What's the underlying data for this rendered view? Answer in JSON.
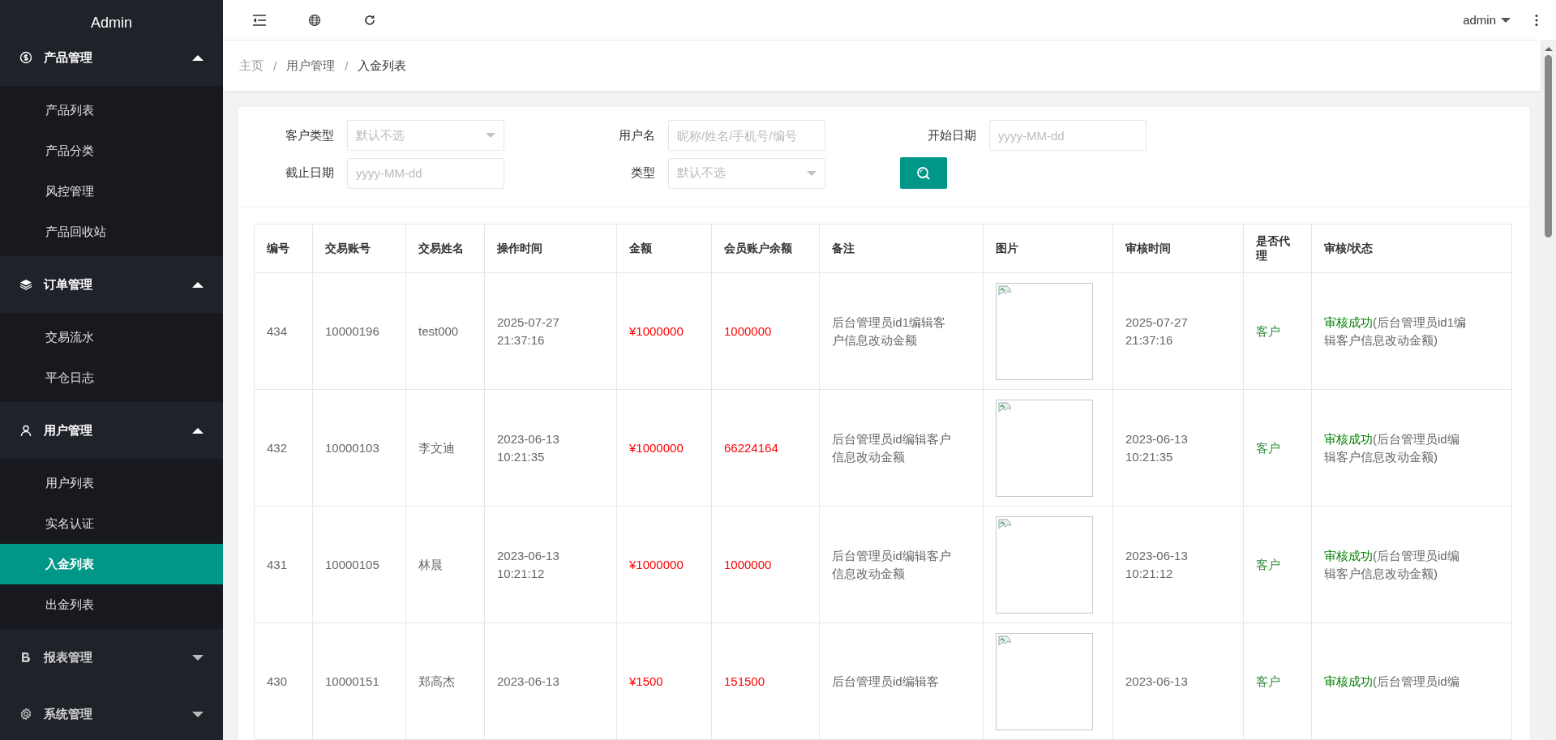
{
  "sidebar": {
    "brand": "Admin",
    "groups": [
      {
        "label": "产品管理",
        "expanded": true,
        "items": [
          {
            "label": "产品列表",
            "selected": false
          },
          {
            "label": "产品分类",
            "selected": false
          },
          {
            "label": "风控管理",
            "selected": false
          },
          {
            "label": "产品回收站",
            "selected": false
          }
        ]
      },
      {
        "label": "订单管理",
        "expanded": true,
        "items": [
          {
            "label": "交易流水",
            "selected": false
          },
          {
            "label": "平仓日志",
            "selected": false
          }
        ]
      },
      {
        "label": "用户管理",
        "expanded": true,
        "items": [
          {
            "label": "用户列表",
            "selected": false
          },
          {
            "label": "实名认证",
            "selected": false
          },
          {
            "label": "入金列表",
            "selected": true
          },
          {
            "label": "出金列表",
            "selected": false
          }
        ]
      },
      {
        "label": "报表管理",
        "expanded": false
      },
      {
        "label": "系统管理",
        "expanded": false
      }
    ]
  },
  "header": {
    "user": "admin"
  },
  "breadcrumb": {
    "separator": "/",
    "items": [
      "主页",
      "用户管理",
      "入金列表"
    ]
  },
  "filters": [
    {
      "label": "客户类型",
      "kind": "select",
      "placeholder": "默认不选"
    },
    {
      "label": "用户名",
      "kind": "input",
      "placeholder": "昵称/姓名/手机号/编号"
    },
    {
      "label": "开始日期",
      "kind": "input",
      "placeholder": "yyyy-MM-dd"
    },
    {
      "label": "截止日期",
      "kind": "input",
      "placeholder": "yyyy-MM-dd"
    },
    {
      "label": "类型",
      "kind": "select",
      "placeholder": "默认不选"
    }
  ],
  "table": {
    "columns": [
      "编号",
      "交易账号",
      "交易姓名",
      "操作时间",
      "金额",
      "会员账户余额",
      "备注",
      "图片",
      "审核时间",
      "是否代理",
      "审核/状态"
    ],
    "rows": [
      {
        "id": "434",
        "account": "10000196",
        "name": "test000",
        "op_time": "2025-07-27 21:37:16",
        "amount": "¥1000000",
        "balance": "1000000",
        "remark": "后台管理员id1编辑客户信息改动金额",
        "audit_time": "2025-07-27 21:37:16",
        "agent": "客户",
        "result": "审核成功",
        "note": "(后台管理员id1编辑客户信息改动金额)"
      },
      {
        "id": "432",
        "account": "10000103",
        "name": "李文迪",
        "op_time": "2023-06-13 10:21:35",
        "amount": "¥1000000",
        "balance": "66224164",
        "remark": "后台管理员id编辑客户信息改动金额",
        "audit_time": "2023-06-13 10:21:35",
        "agent": "客户",
        "result": "审核成功",
        "note": "(后台管理员id编辑客户信息改动金额)"
      },
      {
        "id": "431",
        "account": "10000105",
        "name": "林晨",
        "op_time": "2023-06-13 10:21:12",
        "amount": "¥1000000",
        "balance": "1000000",
        "remark": "后台管理员id编辑客户信息改动金额",
        "audit_time": "2023-06-13 10:21:12",
        "agent": "客户",
        "result": "审核成功",
        "note": "(后台管理员id编辑客户信息改动金额)"
      },
      {
        "id": "430",
        "account": "10000151",
        "name": "郑高杰",
        "op_time": "2023-06-13",
        "amount": "¥1500",
        "balance": "151500",
        "remark": "后台管理员id编辑客",
        "audit_time": "2023-06-13",
        "agent": "客户",
        "result": "审核成功",
        "note": "(后台管理员id编"
      }
    ]
  }
}
